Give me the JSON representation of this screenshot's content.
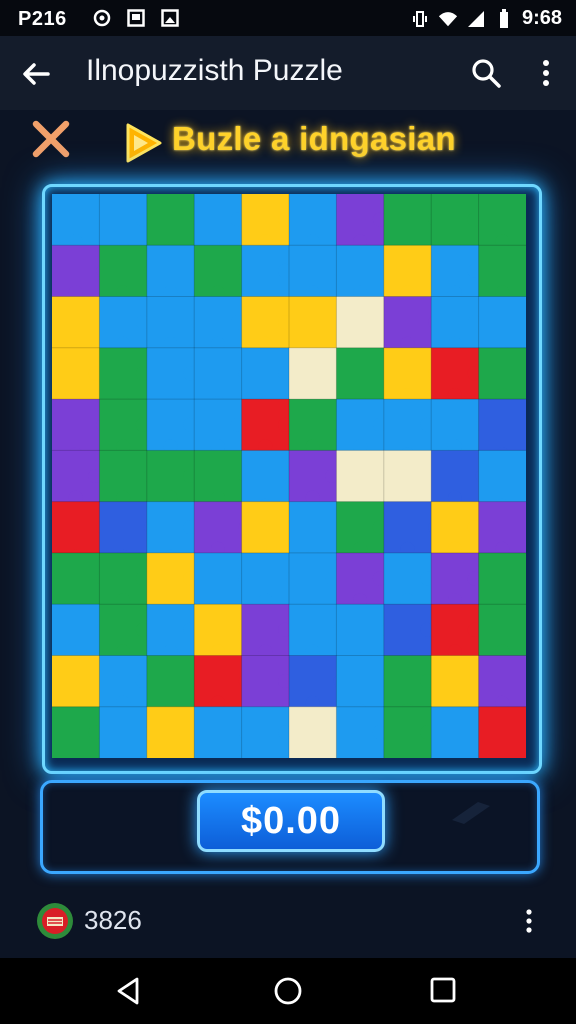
{
  "status_bar": {
    "time_left": "P216",
    "time_right": "9:68",
    "icons": [
      "sync-icon",
      "image-icon",
      "photo-icon",
      "vibrate-icon",
      "wifi-icon",
      "signal-icon",
      "battery-icon"
    ]
  },
  "app_bar": {
    "title": "Ilnopuzzisth Puzzle",
    "icons": [
      "back-arrow-icon",
      "search-icon",
      "more-vert-icon"
    ]
  },
  "level": {
    "title": "Buzle a idngasian",
    "close_icon": "close-x-icon",
    "badge_icon": "play-badge-icon",
    "accent_color": "#ffd22a"
  },
  "board": {
    "rows": 11,
    "cols": 10,
    "glow_color": "#2ab8ff",
    "piece_colors": [
      "#1ea84b",
      "#1e9bf0",
      "#7b3fd6",
      "#ffcc17",
      "#e81d24",
      "#f3ecc9",
      "#2f5fe0"
    ]
  },
  "wallet": {
    "price": "$0.00"
  },
  "footer": {
    "count": "3826",
    "avatar_icon": "avatar-icon",
    "menu_icon": "more-vert-icon"
  },
  "nav_bar": {
    "icons": [
      "nav-back-icon",
      "nav-home-icon",
      "nav-recents-icon"
    ]
  }
}
